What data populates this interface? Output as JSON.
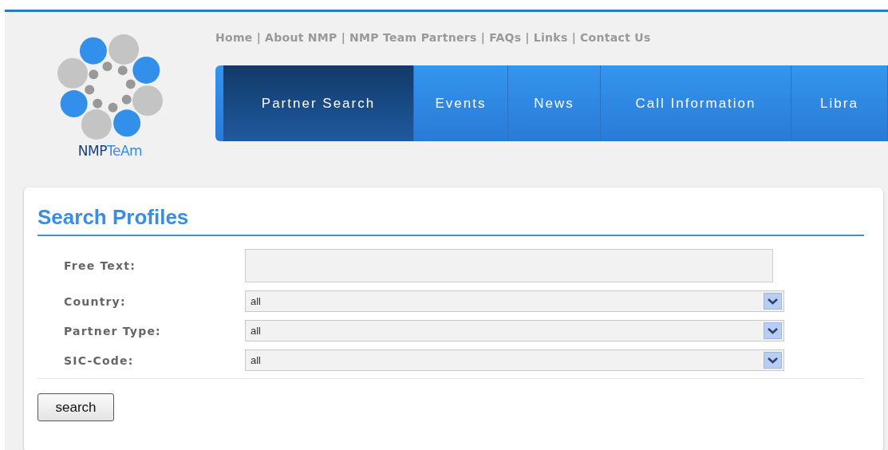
{
  "logo": {
    "name_part_1": "NMP",
    "name_part_2": "TeAm"
  },
  "top_links": {
    "separator": "|",
    "items": [
      "Home",
      "About NMP",
      "NMP Team Partners",
      "FAQs",
      "Links",
      "Contact Us"
    ]
  },
  "nav": [
    {
      "label": "Partner Search",
      "selected": true
    },
    {
      "label": "Events",
      "selected": false
    },
    {
      "label": "News",
      "selected": false
    },
    {
      "label": "Call Information",
      "selected": false
    },
    {
      "label": "Libra",
      "selected": false
    }
  ],
  "search_panel": {
    "title": "Search Profiles",
    "fields": [
      {
        "label": "Free Text:",
        "kind": "text"
      },
      {
        "label": "Country:",
        "kind": "select",
        "value": "all"
      },
      {
        "label": "Partner Type:",
        "kind": "select",
        "value": "all"
      },
      {
        "label": "SIC-Code:",
        "kind": "select",
        "value": "all"
      }
    ],
    "button": "search"
  }
}
